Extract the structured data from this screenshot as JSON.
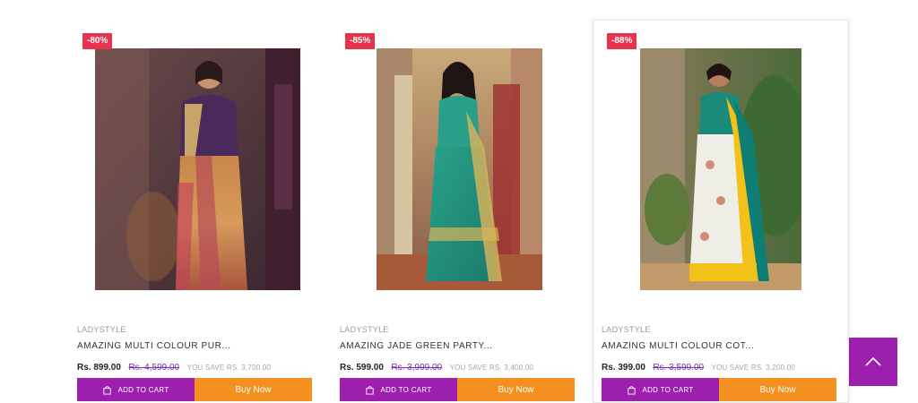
{
  "products": [
    {
      "discount": "-80%",
      "brand": "LADYSTYLE",
      "name": "AMAZING MULTI COLOUR PUR...",
      "price": "Rs. 899.00",
      "old_price": "Rs. 4,599.00",
      "savings": "YOU SAVE RS. 3,700.00",
      "add_to_cart": "ADD TO CART",
      "buy_now": "Buy Now",
      "image_icon": "saree-photo-icon"
    },
    {
      "discount": "-85%",
      "brand": "LADYSTYLE",
      "name": "AMAZING JADE GREEN PARTY...",
      "price": "Rs. 599.00",
      "old_price": "Rs. 3,999.00",
      "savings": "YOU SAVE RS. 3,400.00",
      "add_to_cart": "ADD TO CART",
      "buy_now": "Buy Now",
      "image_icon": "saree-photo-icon"
    },
    {
      "discount": "-88%",
      "brand": "LADYSTYLE",
      "name": "AMAZING MULTI COLOUR COT...",
      "price": "Rs. 399.00",
      "old_price": "Rs. 3,599.00",
      "savings": "YOU SAVE RS. 3,200.00",
      "add_to_cart": "ADD TO CART",
      "buy_now": "Buy Now",
      "image_icon": "saree-photo-icon"
    }
  ],
  "colors": {
    "badge": "#e8334f",
    "add_to_cart": "#9c1fae",
    "buy_now": "#f39020",
    "old_price": "#7a2ea8"
  },
  "scroll_top_icon": "chevron-up-icon"
}
